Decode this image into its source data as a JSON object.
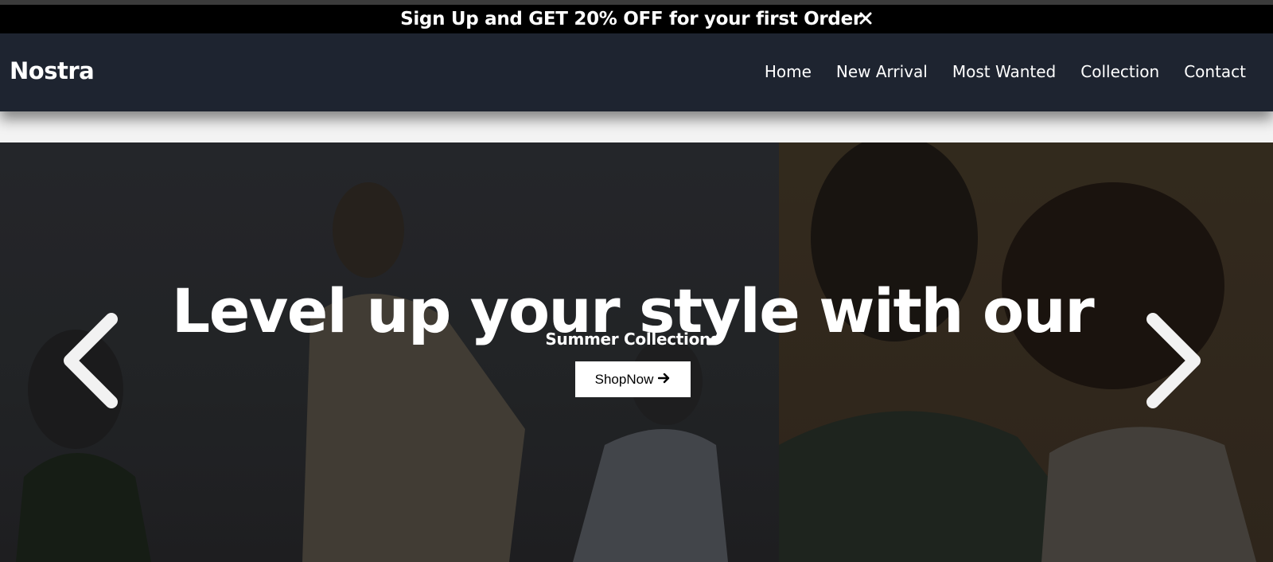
{
  "promo": {
    "text": "Sign Up and GET 20% OFF for your first Order",
    "close_icon": "close-icon"
  },
  "nav": {
    "logo": "Nostra",
    "links": [
      "Home",
      "New Arrival",
      "Most Wanted",
      "Collection",
      "Contact"
    ]
  },
  "hero": {
    "title": "Level up your style with our",
    "subtitle": "Summer Collections",
    "button_label": "ShopNow",
    "button_icon": "arrow-right-icon",
    "prev_icon": "chevron-left-icon",
    "next_icon": "chevron-right-icon"
  },
  "colors": {
    "promo_bg": "#000000",
    "nav_bg": "#1e2430",
    "text": "#ffffff"
  }
}
